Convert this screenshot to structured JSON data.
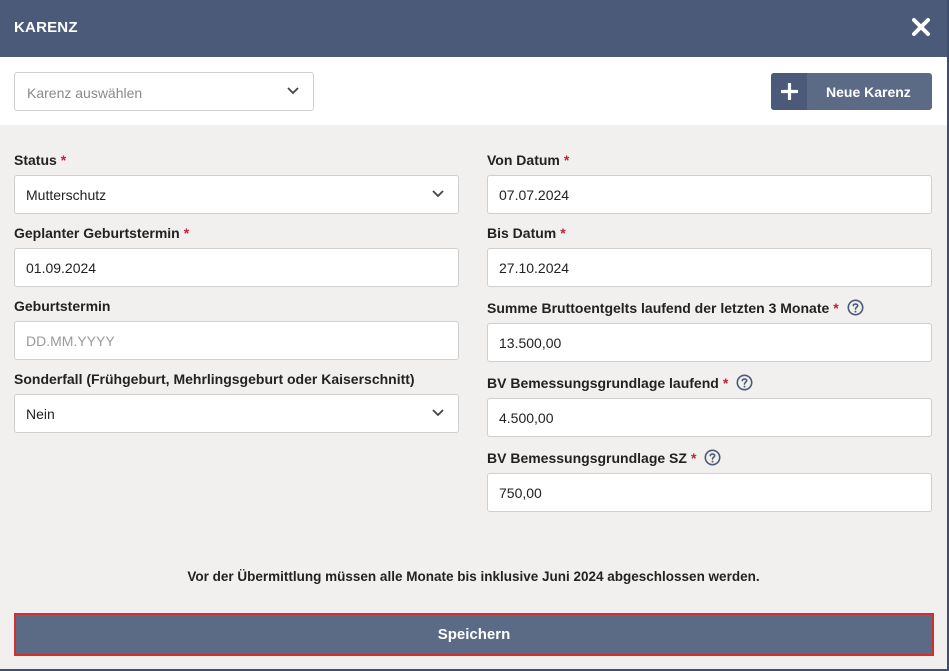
{
  "dialog": {
    "title": "KARENZ",
    "close_icon": "close-x-icon"
  },
  "toolbar": {
    "karenz_select_placeholder": "Karenz auswählen",
    "new_button_label": "Neue Karenz",
    "new_button_icon": "plus-icon"
  },
  "form": {
    "status": {
      "label": "Status",
      "required": "*",
      "value": "Mutterschutz"
    },
    "geplanter_geburtstermin": {
      "label": "Geplanter Geburtstermin",
      "required": "*",
      "value": "01.09.2024"
    },
    "geburtstermin": {
      "label": "Geburtstermin",
      "placeholder": "DD.MM.YYYY"
    },
    "sonderfall": {
      "label": "Sonderfall (Frühgeburt, Mehrlingsgeburt oder Kaiserschnitt)",
      "value": "Nein"
    },
    "von_datum": {
      "label": "Von Datum",
      "required": "*",
      "value": "07.07.2024"
    },
    "bis_datum": {
      "label": "Bis Datum",
      "required": "*",
      "value": "27.10.2024"
    },
    "summe_brutto": {
      "label": "Summe Bruttoentgelts laufend der letzten 3 Monate",
      "required": "*",
      "value": "13.500,00"
    },
    "bv_laufend": {
      "label": "BV Bemessungsgrundlage laufend",
      "required": "*",
      "value": "4.500,00"
    },
    "bv_sz": {
      "label": "BV Bemessungsgrundlage SZ",
      "required": "*",
      "value": "750,00"
    }
  },
  "notice": "Vor der Übermittlung müssen alle Monate bis inklusive Juni 2024 abgeschlossen werden.",
  "save_button_label": "Speichern",
  "colors": {
    "header": "#4a5a78",
    "button": "#5b6b86",
    "required": "#c0223b",
    "highlight": "#d32f2f"
  }
}
